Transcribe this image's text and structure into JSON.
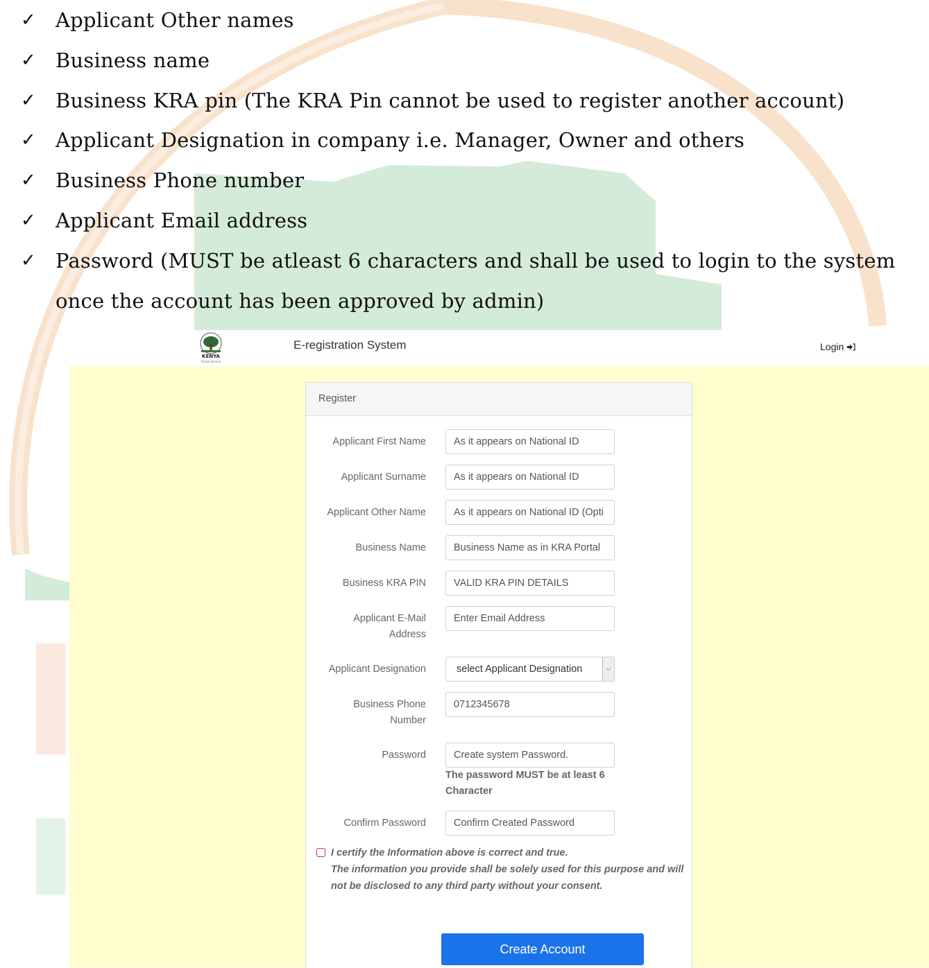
{
  "checklist": {
    "items": [
      "Applicant Other names",
      "Business name",
      "Business KRA pin (The KRA Pin cannot be used to register another account)",
      "Applicant Designation in company i.e. Manager, Owner and others",
      "Business Phone number",
      "Applicant Email address",
      "Password (MUST be atleast 6 characters and shall be used to login to the system"
    ],
    "continuation": "once the account has been approved by admin)",
    "check_symbol": "✓"
  },
  "header": {
    "app_title": "E-registration System",
    "login_label": "Login",
    "login_icon": "sign-in-icon",
    "logo_text": "KENYA",
    "logo_subtext": "Forest Service"
  },
  "form": {
    "title": "Register",
    "fields": {
      "first_name": {
        "label": "Applicant First Name",
        "placeholder": "As it appears on National ID"
      },
      "surname": {
        "label": "Applicant Surname",
        "placeholder": "As it appears on National ID"
      },
      "other_name": {
        "label": "Applicant Other Name",
        "placeholder": "As it appears on National ID (Opti"
      },
      "business_name": {
        "label": "Business Name",
        "placeholder": "Business Name as in KRA Portal"
      },
      "kra_pin": {
        "label": "Business KRA PIN",
        "placeholder": "VALID KRA PIN DETAILS"
      },
      "email": {
        "label_line1": "Applicant E-Mail",
        "label_line2": "Address",
        "placeholder": "Enter Email Address"
      },
      "designation": {
        "label": "Applicant Designation",
        "selected": "select Applicant Designation"
      },
      "phone": {
        "label_line1": "Business Phone",
        "label_line2": "Number",
        "placeholder": "0712345678"
      },
      "password": {
        "label": "Password",
        "placeholder": "Create system Password.",
        "hint_line1": "The password MUST be at least 6",
        "hint_line2": "Character"
      },
      "confirm_password": {
        "label": "Confirm Password",
        "placeholder": "Confirm Created Password"
      }
    },
    "certify": {
      "line1": "I certify the Information above is correct and true.",
      "line2": "The information you provide shall be solely used for this purpose and will",
      "line3": "not be disclosed to any third party without your consent."
    },
    "submit_label": "Create Account"
  },
  "colors": {
    "accent": "#1a73e8",
    "body_bg": "#fffccd",
    "watermark_orange": "#f6d9c0",
    "watermark_green": "#d4ead8"
  }
}
